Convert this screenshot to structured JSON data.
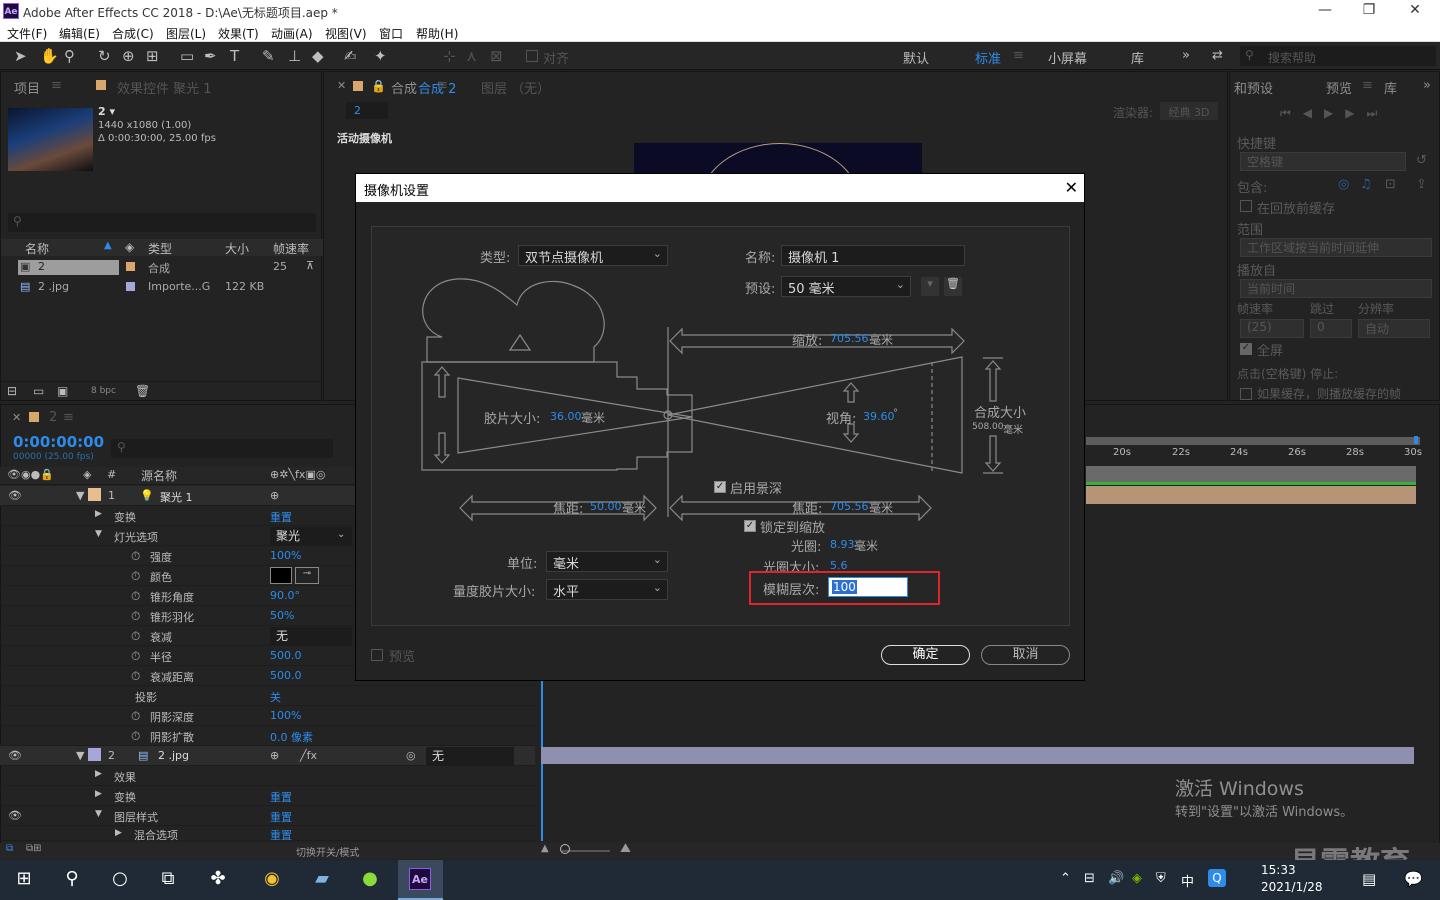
{
  "app": {
    "title": "Adobe After Effects CC 2018 - D:\\Ae\\无标题项目.aep *",
    "logo": "Ae"
  },
  "window_controls": {
    "minimize": "—",
    "restore": "❐",
    "close": "✕"
  },
  "menu": [
    "文件(F)",
    "编辑(E)",
    "合成(C)",
    "图层(L)",
    "效果(T)",
    "动画(A)",
    "视图(V)",
    "窗口",
    "帮助(H)"
  ],
  "toolbar": {
    "align_label": "对齐",
    "workspaces": [
      "默认",
      "标准",
      "小屏幕",
      "库"
    ],
    "active_workspace": "标准",
    "search_placeholder": "搜索帮助"
  },
  "project_panel": {
    "tab": "项目",
    "tab2": "效果控件 聚光 1",
    "comp_name": "2 ▾",
    "comp_res": "1440 x1080 (1.00)",
    "comp_dur": "Δ 0:00:30:00, 25.00 fps",
    "columns": [
      "名称",
      "类型",
      "大小",
      "帧速率"
    ],
    "rows": [
      {
        "name": "2",
        "type": "合成",
        "size": "",
        "fps": "25"
      },
      {
        "name": "2 .jpg",
        "type": "Importe...G",
        "size": "122 KB",
        "fps": ""
      }
    ],
    "bpc": "8 bpc"
  },
  "viewer": {
    "tab": "合成 2",
    "tab2": "图层 （无）",
    "comp_chip": "2",
    "renderer_label": "渲染器:",
    "renderer": "经典 3D",
    "active_camera": "活动摄像机"
  },
  "right_panel": {
    "tab1": "和预设",
    "tab2": "预览",
    "tab3": "库",
    "shortcut_label": "快捷键",
    "shortcut": "空格键",
    "include_label": "包含:",
    "cache_before": "在回放前缓存",
    "range_label": "范围",
    "range": "工作区域按当前时间延伸",
    "play_from_label": "播放自",
    "play_from": "当前时间",
    "fps_label": "帧速率",
    "skip_label": "跳过",
    "res_label": "分辨率",
    "fps": "(25)",
    "skip": "0",
    "res": "自动",
    "fullscreen": "全屏",
    "stop_hint": "点击(空格键) 停止:",
    "cache_hint": "如果缓存，则播放缓存的帧"
  },
  "timeline": {
    "tab": "2",
    "timecode": "0:00:00:00",
    "timecode_sub": "00000 (25.00 fps)",
    "source_col": "源名称",
    "num_col": "#",
    "ruler": [
      "20s",
      "22s",
      "24s",
      "26s",
      "28s",
      "30s"
    ],
    "rows": [
      {
        "label": "1",
        "name": "聚光 1",
        "value": ""
      },
      {
        "label": "变换",
        "value": "重置"
      },
      {
        "label": "灯光选项",
        "value": "聚光"
      },
      {
        "label": "强度",
        "value": "100%"
      },
      {
        "label": "颜色",
        "value": ""
      },
      {
        "label": "锥形角度",
        "value": "90.0°"
      },
      {
        "label": "锥形羽化",
        "value": "50%"
      },
      {
        "label": "衰减",
        "value": "无"
      },
      {
        "label": "半径",
        "value": "500.0"
      },
      {
        "label": "衰减距离",
        "value": "500.0"
      },
      {
        "label": "投影",
        "value": "关"
      },
      {
        "label": "阴影深度",
        "value": "100%"
      },
      {
        "label": "阴影扩散",
        "value": "0.0 像素"
      },
      {
        "label": "2",
        "name": "2 .jpg",
        "value": "无"
      },
      {
        "label": "效果",
        "value": ""
      },
      {
        "label": "变换",
        "value": "重置"
      },
      {
        "label": "图层样式",
        "value": "重置"
      },
      {
        "label": "混合选项",
        "value": "重置"
      }
    ],
    "bottom_label": "切换开关/模式"
  },
  "dialog": {
    "title": "摄像机设置",
    "type_label": "类型:",
    "type": "双节点摄像机",
    "name_label": "名称:",
    "name": "摄像机 1",
    "preset_label": "预设:",
    "preset": "50 毫米",
    "zoom_label": "缩放:",
    "zoom": "705.56",
    "film_label": "胶片大小:",
    "film": "36.00",
    "angle_label": "视角:",
    "angle": "39.60",
    "angle_unit": "°",
    "comp_size_label": "合成大小",
    "comp_size": "508.00",
    "unit_mm": "毫米",
    "dof_label": "启用景深",
    "focal_label": "焦距:",
    "focal": "50.00",
    "focus_label": "焦距:",
    "focus": "705.56",
    "lock_zoom_label": "锁定到缩放",
    "aperture_label": "光圈:",
    "aperture": "8.93",
    "fstop_label": "光圈大小:",
    "fstop": "5.6",
    "units_label": "单位:",
    "units": "毫米",
    "measure_label": "量度胶片大小:",
    "measure": "水平",
    "blur_label": "模糊层次:",
    "blur": "100",
    "blur_suffix": "%",
    "preview_label": "预览",
    "ok": "确定",
    "cancel": "取消"
  },
  "watermark": {
    "line1": "激活 Windows",
    "line2": "转到\"设置\"以激活 Windows。",
    "brand": "易需教育"
  },
  "taskbar": {
    "time": "15:33",
    "date": "2021/1/28",
    "ime": "中",
    "ae_label": "Ae"
  },
  "colors": {
    "accent": "#2d8ceb",
    "highlight": "#e0242a"
  }
}
